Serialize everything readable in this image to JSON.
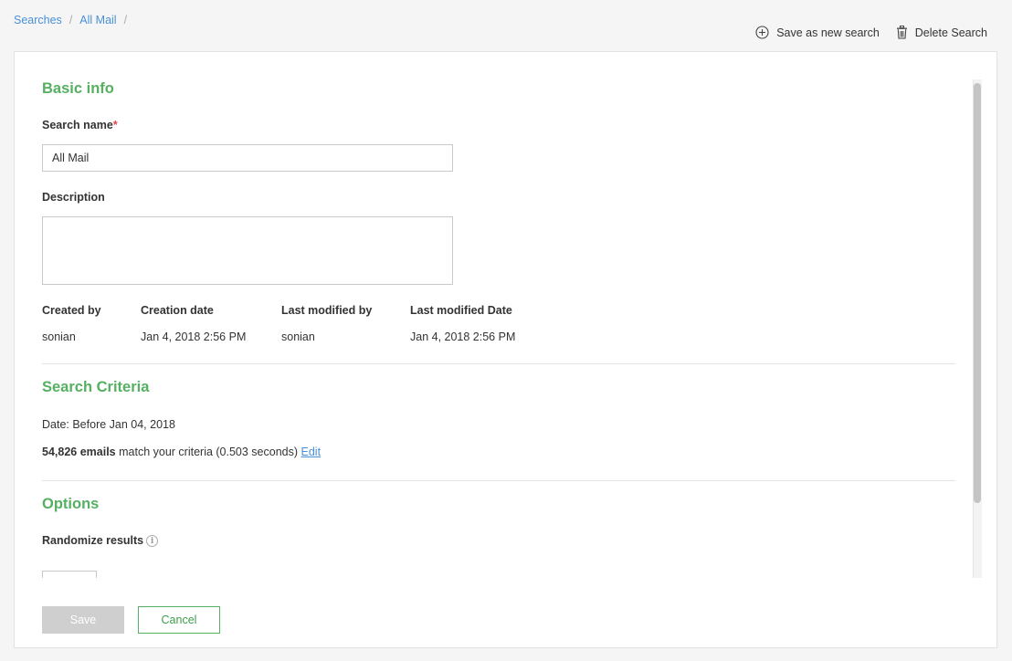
{
  "breadcrumb": {
    "items": [
      "Searches",
      "All Mail"
    ],
    "separator": "/"
  },
  "top_actions": {
    "save_as_new": "Save as new search",
    "delete": "Delete Search"
  },
  "basic_info": {
    "title": "Basic info",
    "search_name_label": "Search name",
    "required_mark": "*",
    "search_name_value": "All Mail",
    "description_label": "Description",
    "description_value": "",
    "meta": {
      "created_by_label": "Created by",
      "created_by_value": "sonian",
      "creation_date_label": "Creation date",
      "creation_date_value": "Jan 4, 2018 2:56 PM",
      "last_modified_by_label": "Last modified by",
      "last_modified_by_value": "sonian",
      "last_modified_date_label": "Last modified Date",
      "last_modified_date_value": "Jan 4, 2018 2:56 PM"
    }
  },
  "search_criteria": {
    "title": "Search Criteria",
    "date_text": "Date: Before Jan 04, 2018",
    "match_count": "54,826 emails",
    "match_text": "match your criteria (0.503 seconds)",
    "edit_label": "Edit"
  },
  "options": {
    "title": "Options",
    "randomize_label": "Randomize results",
    "info_glyph": "i"
  },
  "footer": {
    "save_label": "Save",
    "cancel_label": "Cancel"
  },
  "colors": {
    "accent_green": "#55b062",
    "link_blue": "#4a90d9",
    "required_red": "#e04848"
  }
}
